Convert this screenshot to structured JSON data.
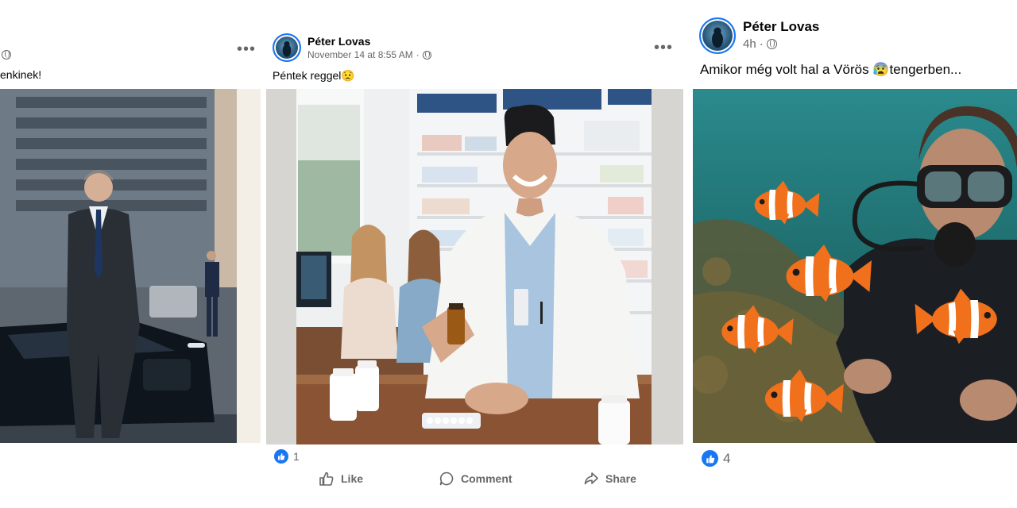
{
  "posts": [
    {
      "id": "left",
      "caption": "enkinek!",
      "more_label": "•••",
      "image_alt": "Man in suit standing next to car in city"
    },
    {
      "id": "middle",
      "author": "Péter Lovas",
      "timestamp": "November 14 at 8:55 AM",
      "separator": "·",
      "more_label": "•••",
      "caption": "Péntek reggel😟",
      "image_alt": "Smiling pharmacist holding a medicine bottle",
      "reaction_count": "1",
      "actions": {
        "like": "Like",
        "comment": "Comment",
        "share": "Share"
      }
    },
    {
      "id": "right",
      "author": "Péter Lovas",
      "timestamp": "4h",
      "separator": "·",
      "caption": "Amikor még volt hal a Vörös 😰tengerben...",
      "image_alt": "Scuba diver with clownfish underwater",
      "reaction_count": "4"
    }
  ],
  "colors": {
    "accent": "#1877f2",
    "secondary_text": "#65676b",
    "primary_text": "#050505"
  },
  "icons": [
    "globe-icon",
    "more-icon",
    "like-reaction-icon",
    "like-icon",
    "comment-icon",
    "share-icon"
  ]
}
